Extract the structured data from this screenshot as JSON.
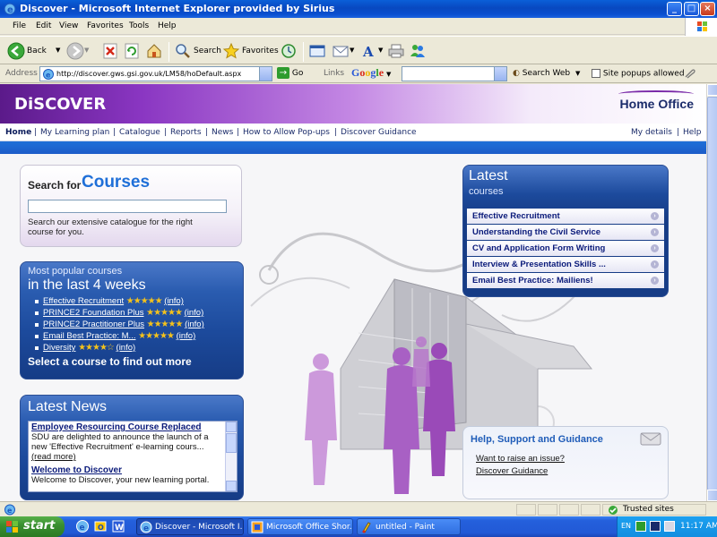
{
  "window": {
    "title": "Discover - Microsoft Internet Explorer provided by Sirius",
    "buttons": [
      "minimize",
      "maximize",
      "close"
    ]
  },
  "menu": [
    "File",
    "Edit",
    "View",
    "Favorites",
    "Tools",
    "Help"
  ],
  "toolbar": {
    "back_label": "Back",
    "search_label": "Search",
    "favorites_label": "Favorites"
  },
  "addressbar": {
    "label": "Address",
    "url": "http://discover.gws.gsi.gov.uk/LM58/hoDefault.aspx",
    "go_label": "Go",
    "links_label": "Links",
    "google_label": "Google",
    "search_web_label": "Search Web",
    "popups_label": "Site popups allowed"
  },
  "site": {
    "logo": "DiSCOVER",
    "brand": "Home Office",
    "nav": [
      "Home",
      "My Learning plan",
      "Catalogue",
      "Reports",
      "News",
      "How to Allow Pop-ups",
      "Discover Guidance"
    ],
    "nav_right": [
      "My details",
      "Help"
    ]
  },
  "search": {
    "title_prefix": "Search for",
    "title_main": "Courses",
    "value": "",
    "description": "Search our extensive catalogue for the right course for you."
  },
  "popular": {
    "title_small": "Most popular courses",
    "title_large": "in the last 4 weeks",
    "items": [
      {
        "name": "Effective Recruitment",
        "stars": "★★★★★",
        "info": "(info)"
      },
      {
        "name": "PRINCE2 Foundation Plus",
        "stars": "★★★★★",
        "info": "(info)"
      },
      {
        "name": "PRINCE2 Practitioner Plus",
        "stars": "★★★★★",
        "info": "(info)"
      },
      {
        "name": "Email Best Practice: M...",
        "stars": "★★★★★",
        "info": "(info)"
      },
      {
        "name": "Diversity",
        "stars": "★★★★☆",
        "info": "(info)"
      }
    ],
    "footer": "Select a course to find out more"
  },
  "news": {
    "title": "Latest News",
    "items": [
      {
        "headline": "Employee Resourcing Course Replaced",
        "body": "SDU are delighted to announce the launch of a new 'Effective Recruitment' e-learning cours...",
        "more": "(read more)"
      },
      {
        "headline": "Welcome to Discover",
        "body": "Welcome to Discover, your new learning portal.",
        "more": ""
      }
    ]
  },
  "latest": {
    "title": "Latest",
    "subtitle": "courses",
    "items": [
      "Effective Recruitment",
      "Understanding the Civil Service",
      "CV and Application Form Writing",
      "Interview & Presentation Skills ...",
      "Email Best Practice: Mailiens!"
    ]
  },
  "help": {
    "title": "Help, Support and Guidance",
    "links": [
      "Want to raise an issue?",
      "Discover Guidance"
    ]
  },
  "statusbar": {
    "zone": "Trusted sites"
  },
  "taskbar": {
    "start_label": "start",
    "tasks": [
      "Discover - Microsoft I...",
      "Microsoft Office Shor...",
      "untitled - Paint"
    ],
    "language": "EN",
    "clock": "11:17 AM"
  },
  "colors": {
    "title_blue": "#0a5fd8",
    "site_purple": "#8a36c2",
    "site_blue": "#1f6fd8",
    "panel_navy": "#1c4a9c",
    "star_gold": "#f4c21c",
    "taskbar_blue": "#2460dc",
    "start_green": "#3a9030"
  }
}
